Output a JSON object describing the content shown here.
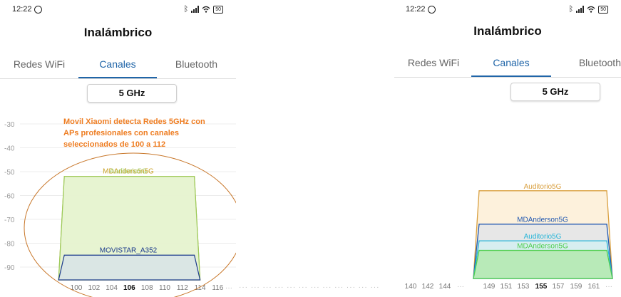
{
  "left": {
    "status": {
      "time": "12:22",
      "battery": "50"
    },
    "title": "Inalámbrico",
    "tabs": [
      {
        "label": "Redes WiFi",
        "active": false
      },
      {
        "label": "Canales",
        "active": true
      },
      {
        "label": "Bluetooth",
        "active": false
      }
    ],
    "band_selector": "5 GHz",
    "annotation": [
      "Movil Xiaomi detecta Redes 5GHz con",
      "APs profesionales con canales",
      "seleccionados de 100 a 112"
    ],
    "chart_data": {
      "type": "area",
      "y_ticks": [
        -30,
        -40,
        -50,
        -60,
        -70,
        -80,
        -90
      ],
      "x_ticks": [
        "100",
        "102",
        "104",
        "106",
        "108",
        "110",
        "112",
        "114",
        "116"
      ],
      "x_highlight": "106",
      "series": [
        {
          "name": "MDAnderson5G",
          "from": 98,
          "to": 114,
          "dbm": -52,
          "stroke": "#c9a227",
          "fill": "#e6f3d0"
        },
        {
          "name": "Auditorio5G",
          "from": 98,
          "to": 114,
          "dbm": -52,
          "stroke": "#9acb5a",
          "fill": "#e6f3d0"
        },
        {
          "name": "MOVISTAR_A352",
          "from": 98,
          "to": 114,
          "dbm": -85,
          "stroke": "#1b3a8c",
          "fill": "#d7e3e8"
        }
      ]
    }
  },
  "right": {
    "status": {
      "time": "12:22",
      "battery": "50"
    },
    "title": "Inalámbrico",
    "tabs": [
      {
        "label": "Redes WiFi",
        "active": false
      },
      {
        "label": "Canales",
        "active": true
      },
      {
        "label": "Bluetooth",
        "active": false
      }
    ],
    "band_selector": "5 GHz",
    "chart_data": {
      "type": "area",
      "x_ticks": [
        "140",
        "142",
        "144",
        "149",
        "151",
        "153",
        "155",
        "157",
        "159",
        "161"
      ],
      "x_highlight": "155",
      "series": [
        {
          "name": "Auditorio5G",
          "dbm": -58,
          "stroke": "#d9a040",
          "fill": "#fdf1dc"
        },
        {
          "name": "MDAnderson5G",
          "dbm": -72,
          "stroke": "#2057b0",
          "fill": "#e7e7e7"
        },
        {
          "name": "Auditorio5G",
          "dbm": -79,
          "stroke": "#27b5d8",
          "fill": "#d7eef0"
        },
        {
          "name": "MDAnderson5G",
          "dbm": -83,
          "stroke": "#4fcf4f",
          "fill": "#b8eab8"
        }
      ]
    }
  },
  "colors": {
    "accent": "#2065a8",
    "annotation": "#ee7d22",
    "ellipse": "#c8772a"
  }
}
